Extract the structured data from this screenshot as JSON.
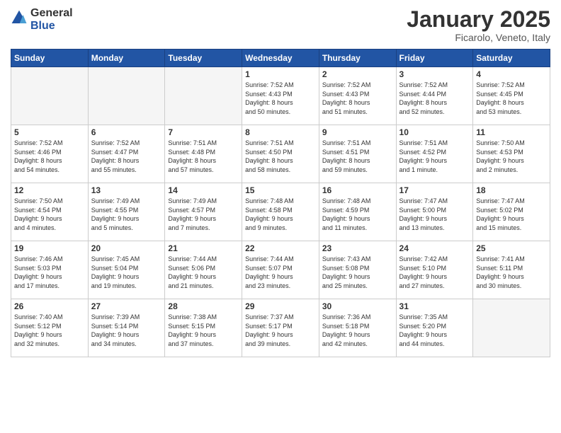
{
  "logo": {
    "general": "General",
    "blue": "Blue"
  },
  "title": "January 2025",
  "subtitle": "Ficarolo, Veneto, Italy",
  "weekdays": [
    "Sunday",
    "Monday",
    "Tuesday",
    "Wednesday",
    "Thursday",
    "Friday",
    "Saturday"
  ],
  "weeks": [
    [
      {
        "day": "",
        "info": "",
        "empty": true
      },
      {
        "day": "",
        "info": "",
        "empty": true
      },
      {
        "day": "",
        "info": "",
        "empty": true
      },
      {
        "day": "1",
        "info": "Sunrise: 7:52 AM\nSunset: 4:43 PM\nDaylight: 8 hours\nand 50 minutes."
      },
      {
        "day": "2",
        "info": "Sunrise: 7:52 AM\nSunset: 4:43 PM\nDaylight: 8 hours\nand 51 minutes."
      },
      {
        "day": "3",
        "info": "Sunrise: 7:52 AM\nSunset: 4:44 PM\nDaylight: 8 hours\nand 52 minutes."
      },
      {
        "day": "4",
        "info": "Sunrise: 7:52 AM\nSunset: 4:45 PM\nDaylight: 8 hours\nand 53 minutes."
      }
    ],
    [
      {
        "day": "5",
        "info": "Sunrise: 7:52 AM\nSunset: 4:46 PM\nDaylight: 8 hours\nand 54 minutes."
      },
      {
        "day": "6",
        "info": "Sunrise: 7:52 AM\nSunset: 4:47 PM\nDaylight: 8 hours\nand 55 minutes."
      },
      {
        "day": "7",
        "info": "Sunrise: 7:51 AM\nSunset: 4:48 PM\nDaylight: 8 hours\nand 57 minutes."
      },
      {
        "day": "8",
        "info": "Sunrise: 7:51 AM\nSunset: 4:50 PM\nDaylight: 8 hours\nand 58 minutes."
      },
      {
        "day": "9",
        "info": "Sunrise: 7:51 AM\nSunset: 4:51 PM\nDaylight: 8 hours\nand 59 minutes."
      },
      {
        "day": "10",
        "info": "Sunrise: 7:51 AM\nSunset: 4:52 PM\nDaylight: 9 hours\nand 1 minute."
      },
      {
        "day": "11",
        "info": "Sunrise: 7:50 AM\nSunset: 4:53 PM\nDaylight: 9 hours\nand 2 minutes."
      }
    ],
    [
      {
        "day": "12",
        "info": "Sunrise: 7:50 AM\nSunset: 4:54 PM\nDaylight: 9 hours\nand 4 minutes."
      },
      {
        "day": "13",
        "info": "Sunrise: 7:49 AM\nSunset: 4:55 PM\nDaylight: 9 hours\nand 5 minutes."
      },
      {
        "day": "14",
        "info": "Sunrise: 7:49 AM\nSunset: 4:57 PM\nDaylight: 9 hours\nand 7 minutes."
      },
      {
        "day": "15",
        "info": "Sunrise: 7:48 AM\nSunset: 4:58 PM\nDaylight: 9 hours\nand 9 minutes."
      },
      {
        "day": "16",
        "info": "Sunrise: 7:48 AM\nSunset: 4:59 PM\nDaylight: 9 hours\nand 11 minutes."
      },
      {
        "day": "17",
        "info": "Sunrise: 7:47 AM\nSunset: 5:00 PM\nDaylight: 9 hours\nand 13 minutes."
      },
      {
        "day": "18",
        "info": "Sunrise: 7:47 AM\nSunset: 5:02 PM\nDaylight: 9 hours\nand 15 minutes."
      }
    ],
    [
      {
        "day": "19",
        "info": "Sunrise: 7:46 AM\nSunset: 5:03 PM\nDaylight: 9 hours\nand 17 minutes."
      },
      {
        "day": "20",
        "info": "Sunrise: 7:45 AM\nSunset: 5:04 PM\nDaylight: 9 hours\nand 19 minutes."
      },
      {
        "day": "21",
        "info": "Sunrise: 7:44 AM\nSunset: 5:06 PM\nDaylight: 9 hours\nand 21 minutes."
      },
      {
        "day": "22",
        "info": "Sunrise: 7:44 AM\nSunset: 5:07 PM\nDaylight: 9 hours\nand 23 minutes."
      },
      {
        "day": "23",
        "info": "Sunrise: 7:43 AM\nSunset: 5:08 PM\nDaylight: 9 hours\nand 25 minutes."
      },
      {
        "day": "24",
        "info": "Sunrise: 7:42 AM\nSunset: 5:10 PM\nDaylight: 9 hours\nand 27 minutes."
      },
      {
        "day": "25",
        "info": "Sunrise: 7:41 AM\nSunset: 5:11 PM\nDaylight: 9 hours\nand 30 minutes."
      }
    ],
    [
      {
        "day": "26",
        "info": "Sunrise: 7:40 AM\nSunset: 5:12 PM\nDaylight: 9 hours\nand 32 minutes."
      },
      {
        "day": "27",
        "info": "Sunrise: 7:39 AM\nSunset: 5:14 PM\nDaylight: 9 hours\nand 34 minutes."
      },
      {
        "day": "28",
        "info": "Sunrise: 7:38 AM\nSunset: 5:15 PM\nDaylight: 9 hours\nand 37 minutes."
      },
      {
        "day": "29",
        "info": "Sunrise: 7:37 AM\nSunset: 5:17 PM\nDaylight: 9 hours\nand 39 minutes."
      },
      {
        "day": "30",
        "info": "Sunrise: 7:36 AM\nSunset: 5:18 PM\nDaylight: 9 hours\nand 42 minutes."
      },
      {
        "day": "31",
        "info": "Sunrise: 7:35 AM\nSunset: 5:20 PM\nDaylight: 9 hours\nand 44 minutes."
      },
      {
        "day": "",
        "info": "",
        "empty": true
      }
    ]
  ]
}
